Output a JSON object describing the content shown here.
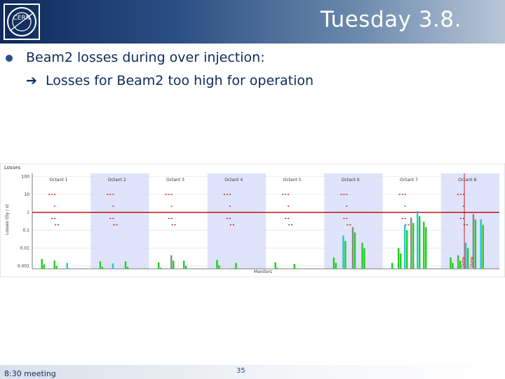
{
  "header": {
    "title": "Tuesday 3.8.",
    "logo_text": "CERN"
  },
  "content": {
    "bullet": "Beam2 losses during over injection:",
    "sub_bullet": "Losses for Beam2 too high for  operation"
  },
  "chart_data": {
    "type": "bar",
    "title": "Losses",
    "ylabel": "Losses (Gy / s)",
    "xlabel": "Monitors",
    "y_scale": "log",
    "yticks": [
      "100",
      "10",
      "1",
      "0.1",
      "0.01",
      "0.001"
    ],
    "octants": [
      "Octant 1",
      "Octant 2",
      "Octant 3",
      "Octant 4",
      "Octant 5",
      "Octant 6",
      "Octant 7",
      "Octant 8"
    ],
    "threshold_value": 1,
    "threshold_color": "#c00000",
    "shaded_octants": [
      2,
      4,
      6,
      8
    ],
    "vertical_labels": [
      "Dump",
      "Dump"
    ],
    "bar_colors": {
      "primary": "#22cc22",
      "secondary": "#20c4d8",
      "tertiary": "#888888"
    }
  },
  "footer": {
    "meeting": "8:30 meeting",
    "page": "35"
  }
}
